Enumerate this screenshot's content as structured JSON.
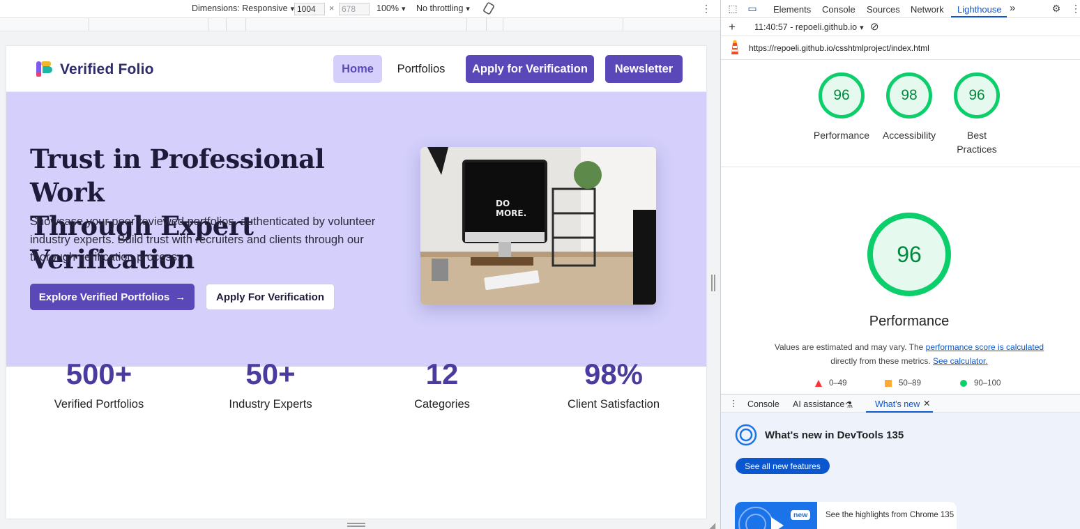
{
  "device_toolbar": {
    "dimensions_label": "Dimensions: Responsive",
    "width": "1004",
    "height": "678",
    "zoom": "100%",
    "throttling": "No throttling"
  },
  "site": {
    "brand": "Verified Folio",
    "nav": {
      "home": "Home",
      "portfolios": "Portfolios",
      "apply": "Apply for Verification",
      "newsletter": "Newsletter"
    },
    "hero": {
      "title_line1": "Trust in Professional Work",
      "title_line2": "Through Expert Verification",
      "subtitle": "Showcase your peer reviewed portfolios, authenticated by volunteer industry experts. Build trust with recruiters and clients through our thorough verification process.",
      "primary_button": "Explore Verified Portfolios",
      "secondary_button": "Apply For Verification",
      "image_text": "DO MORE."
    },
    "stats": [
      {
        "value": "500+",
        "label": "Verified Portfolios"
      },
      {
        "value": "50+",
        "label": "Industry Experts"
      },
      {
        "value": "12",
        "label": "Categories"
      },
      {
        "value": "98%",
        "label": "Client Satisfaction"
      }
    ]
  },
  "devtools": {
    "tabs": [
      "Elements",
      "Console",
      "Sources",
      "Network",
      "Lighthouse"
    ],
    "active_tab": "Lighthouse",
    "report_time": "11:40:57 - repoeli.github.io",
    "url": "https://repoeli.github.io/csshtmlproject/index.html",
    "scores": [
      {
        "value": "96",
        "label": "Performance"
      },
      {
        "value": "98",
        "label": "Accessibility"
      },
      {
        "value": "96",
        "label": "Best Practices"
      }
    ],
    "performance": {
      "score": "96",
      "title": "Performance",
      "note_prefix": "Values are estimated and may vary. The ",
      "note_link": "performance score is calculated",
      "note_mid": "directly from these metrics. ",
      "note_link2": "See calculator."
    },
    "legend": {
      "low": "0–49",
      "mid": "50–89",
      "high": "90–100"
    },
    "drawer": {
      "tabs": [
        "Console",
        "AI assistance",
        "What's new"
      ],
      "active_tab": "What's new",
      "title": "What's new in DevTools 135",
      "button": "See all new features",
      "card_badge": "new",
      "card_text": "See the highlights from Chrome 135"
    }
  },
  "colors": {
    "brand": "#5a48b8",
    "hero_bg": "#d4d0fb",
    "score_green": "#0cce6b",
    "devtools_blue": "#0b57d0"
  }
}
